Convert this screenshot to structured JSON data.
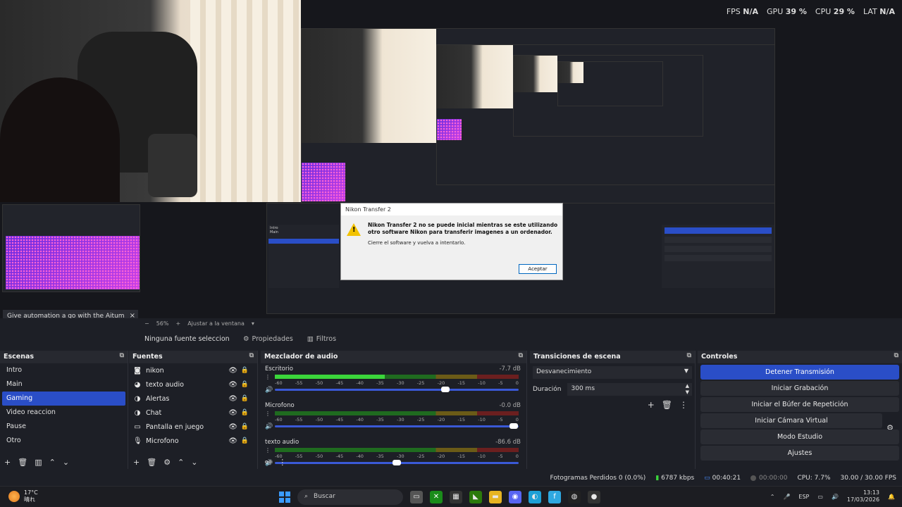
{
  "stats": {
    "fps_label": "FPS",
    "fps_value": "N/A",
    "gpu_label": "GPU",
    "gpu_value": "39 %",
    "cpu_label": "CPU",
    "cpu_value": "29 %",
    "lat_label": "LAT",
    "lat_value": "N/A"
  },
  "dialog": {
    "title": "Nikon Transfer 2",
    "message": "Nikon Transfer 2 no se puede inicial mientras se este utilizando otro software Nikon para transferir imagenes a un ordenador.",
    "sub": "Cierre el software y vuelva a intentarlo.",
    "button": "Aceptar"
  },
  "browser_dock": {
    "title": "Give automation a go with the Aitum App",
    "close": "×"
  },
  "zoom": {
    "value": "56%",
    "fit_label": "Ajustar a la ventana"
  },
  "source_toolbar": {
    "no_source": "Ninguna fuente seleccionada",
    "properties": "Propiedades",
    "filters": "Filtros"
  },
  "scenes": {
    "title": "Escenas",
    "items": [
      "Intro",
      "Main",
      "Gaming",
      "Video reaccion",
      "Pause",
      "Otro"
    ],
    "selected": "Gaming"
  },
  "sources": {
    "title": "Fuentes",
    "items": [
      {
        "label": "nikon",
        "icon": "camera-icon"
      },
      {
        "label": "texto audio",
        "icon": "audio-icon"
      },
      {
        "label": "Alertas",
        "icon": "browser-icon"
      },
      {
        "label": "Chat",
        "icon": "browser-icon"
      },
      {
        "label": "Pantalla en juego",
        "icon": "monitor-icon"
      },
      {
        "label": "Microfono",
        "icon": "mic-icon"
      }
    ]
  },
  "mixer": {
    "title": "Mezclador de audio",
    "scale": [
      "-60",
      "-55",
      "-50",
      "-45",
      "-40",
      "-35",
      "-30",
      "-25",
      "-20",
      "-15",
      "-10",
      "-5",
      "0"
    ],
    "tracks": [
      {
        "name": "Escritorio",
        "db": "-7.7 dB",
        "level": 0.45,
        "volume": 0.7
      },
      {
        "name": "Microfono",
        "db": "-0.0 dB",
        "level": 0,
        "volume": 0.98
      },
      {
        "name": "texto audio",
        "db": "-86.6 dB",
        "level": 0,
        "volume": 0.5
      }
    ]
  },
  "transitions": {
    "title": "Transiciones de escena",
    "selected": "Desvanecimiento",
    "duration_label": "Duración",
    "duration_value": "300 ms"
  },
  "controls": {
    "title": "Controles",
    "stop_stream": "Detener Transmisión",
    "start_recording": "Iniciar Grabación",
    "replay_buffer": "Iniciar el Búfer de Repetición",
    "virtual_cam": "Iniciar Cámara Virtual",
    "studio_mode": "Modo Estudio",
    "settings": "Ajustes"
  },
  "statusbar": {
    "dropped": "Fotogramas Perdidos 0 (0.0%)",
    "bitrate": "6787 kbps",
    "stream_time": "00:40:21",
    "rec_time": "00:00:00",
    "cpu": "CPU: 7.7%",
    "fps": "30.00 / 30.00 FPS"
  },
  "taskbar": {
    "temp": "17°C",
    "weather": "晴れ",
    "search": "Buscar",
    "lang": "ESP",
    "time": "13:13",
    "date": "17/03/2026"
  }
}
